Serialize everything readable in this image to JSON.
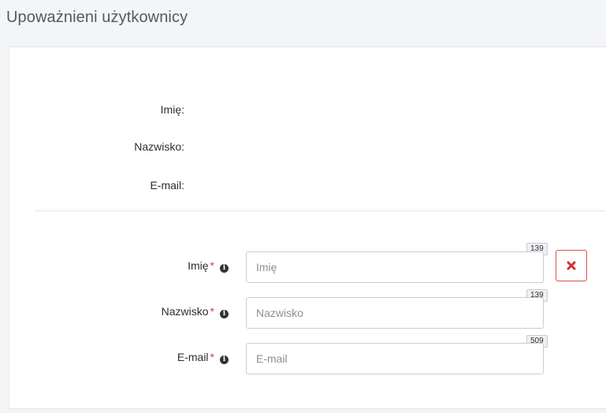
{
  "page": {
    "title": "Upoważnieni użytkownicy"
  },
  "summary": {
    "first_name_label": "Imię:",
    "last_name_label": "Nazwisko:",
    "email_label": "E-mail:"
  },
  "form": {
    "required_marker": "*",
    "info_glyph": "i",
    "first_name": {
      "label": "Imię",
      "placeholder": "Imię",
      "value": "",
      "remaining": "139"
    },
    "last_name": {
      "label": "Nazwisko",
      "placeholder": "Nazwisko",
      "value": "",
      "remaining": "139"
    },
    "email": {
      "label": "E-mail",
      "placeholder": "E-mail",
      "value": "",
      "remaining": "509"
    },
    "remove_button": {
      "icon": "close-icon",
      "color": "#d9534f"
    }
  }
}
